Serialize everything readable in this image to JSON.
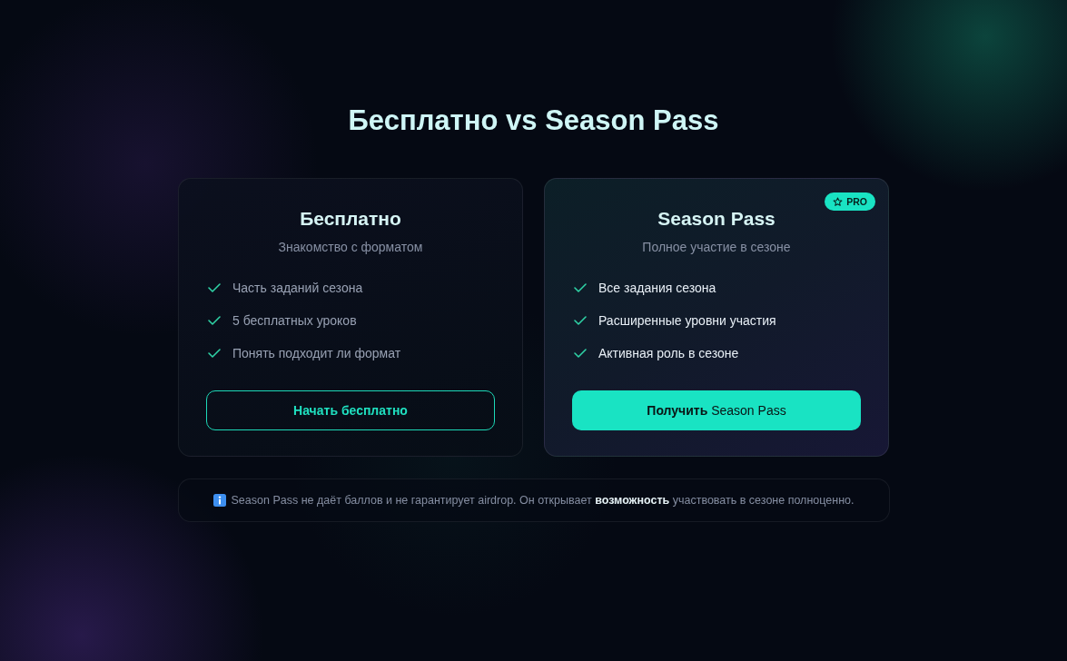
{
  "title": "Бесплатно vs Season Pass",
  "plans": [
    {
      "name": "Бесплатно",
      "subtitle": "Знакомство с форматом",
      "highlighted": false,
      "features": [
        "Часть заданий сезона",
        "5 бесплатных уроков",
        "Понять подходит ли формат"
      ],
      "button": {
        "label": "Начать бесплатно",
        "kind": "outline"
      }
    },
    {
      "name": "Season Pass",
      "subtitle": "Полное участие в сезоне",
      "badge": "PRO",
      "highlighted": true,
      "features": [
        "Все задания сезона",
        "Расширенные уровни участия",
        "Активная роль в сезоне"
      ],
      "button": {
        "label": "**Получить** Season Pass",
        "kind": "filled"
      }
    }
  ],
  "note": "Season Pass не даёт баллов и не гарантирует airdrop. Он открывает **возможность** участвовать в сезоне полноценно."
}
